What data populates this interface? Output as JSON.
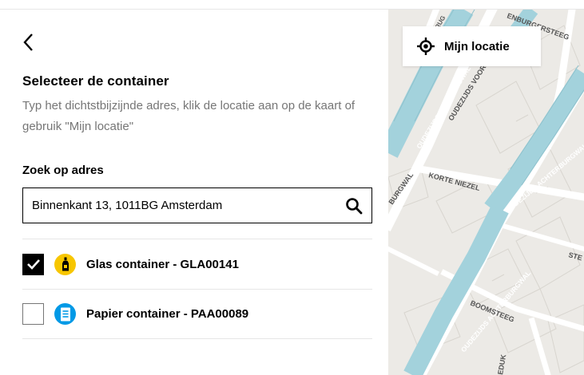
{
  "panel": {
    "title": "Selecteer de container",
    "subtitle": "Typ het dichtstbijzijnde adres, klik de locatie aan op de kaart of gebruik \"Mijn locatie\"",
    "search_label": "Zoek op adres",
    "search_value": "Binnenkant 13, 1011BG Amsterdam"
  },
  "containers": [
    {
      "label": "Glas container - GLA00141",
      "checked": true,
      "icon": "bottle-icon",
      "color": "#f7c600"
    },
    {
      "label": "Papier container - PAA00089",
      "checked": false,
      "icon": "paper-icon",
      "color": "#0099e6"
    }
  ],
  "map": {
    "locate_label": "Mijn locatie",
    "streets": [
      "OUDEZIJDS VOORBURGWAL",
      "OUDEZIJDS VOORB",
      "OUDEZIJDS ACHTERBURGWAL",
      "OUDEZIJDS ACHTERBURGWAL",
      "KORTE NIEZEL",
      "BOOMSTEEG",
      "BURGWAL",
      "ENBURGERSTEEG",
      "BRUG",
      "STE",
      "EDUK"
    ],
    "colors": {
      "water": "#a3d2dc",
      "land": "#eceae6",
      "roads": "#ffffff"
    }
  }
}
